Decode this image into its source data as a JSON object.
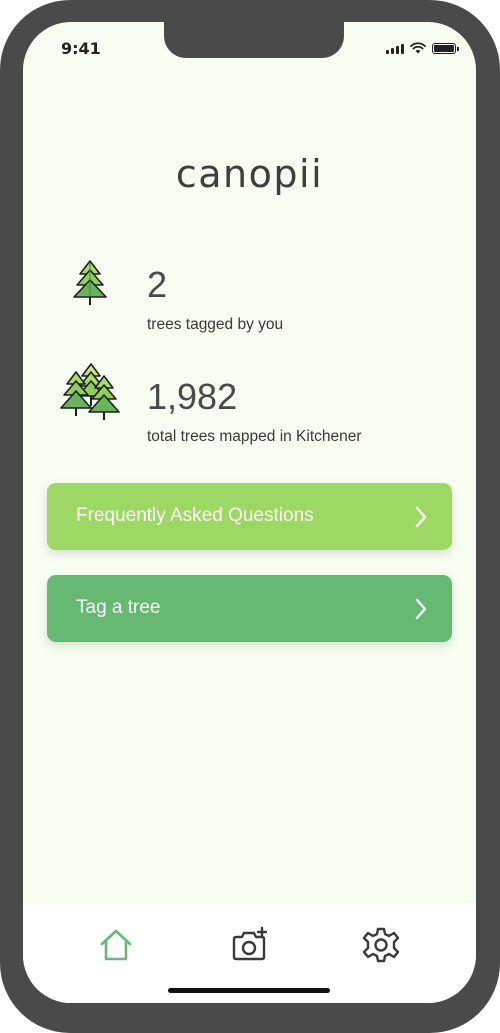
{
  "status_bar": {
    "time": "9:41"
  },
  "app": {
    "title": "canopii"
  },
  "stats": [
    {
      "value": "2",
      "label": "trees tagged by you",
      "icon": "tree-icon"
    },
    {
      "value": "1,982",
      "label": "total trees mapped in Kitchener",
      "icon": "forest-icon"
    }
  ],
  "buttons": {
    "faq": {
      "label": "Frequently Asked Questions",
      "color": "#9dd864"
    },
    "tag": {
      "label": "Tag a tree",
      "color": "#65b973"
    }
  },
  "tabbar": {
    "items": [
      {
        "icon": "home-icon",
        "active": true
      },
      {
        "icon": "camera-add-icon",
        "active": false
      },
      {
        "icon": "settings-icon",
        "active": false
      }
    ],
    "active_color": "#65b973",
    "inactive_color": "#3a3a3a"
  },
  "colors": {
    "background": "#f7fdf0",
    "frame": "#4a4a4a"
  }
}
